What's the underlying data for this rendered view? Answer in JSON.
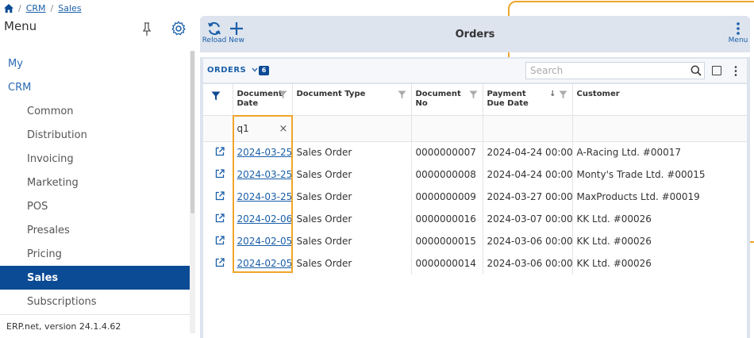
{
  "breadcrumb": {
    "items": [
      "CRM",
      "Sales"
    ]
  },
  "sidebar": {
    "title": "Menu",
    "items": [
      {
        "label": "My",
        "level": 1
      },
      {
        "label": "CRM",
        "level": 1
      },
      {
        "label": "Common",
        "level": 2
      },
      {
        "label": "Distribution",
        "level": 2
      },
      {
        "label": "Invoicing",
        "level": 2
      },
      {
        "label": "Marketing",
        "level": 2
      },
      {
        "label": "POS",
        "level": 2
      },
      {
        "label": "Presales",
        "level": 2
      },
      {
        "label": "Pricing",
        "level": 2
      },
      {
        "label": "Sales",
        "level": 2,
        "active": true
      },
      {
        "label": "Subscriptions",
        "level": 2
      }
    ],
    "version": "ERP.net, version 24.1.4.62"
  },
  "toolbar": {
    "reload_label": "Reload",
    "new_label": "New",
    "title": "Orders",
    "menu_label": "Menu"
  },
  "grid": {
    "orders_label": "ORDERS",
    "count": "6",
    "search_placeholder": "Search",
    "columns": {
      "doc_date": "Document Date",
      "doc_type": "Document Type",
      "doc_no": "Document No",
      "payment_due": "Payment Due Date",
      "customer": "Customer"
    },
    "filter_value": "q1",
    "rows": [
      {
        "date": "2024-03-25",
        "type": "Sales Order",
        "no": "0000000007",
        "due": "2024-04-24 00:00",
        "customer": "A-Racing Ltd. #00017"
      },
      {
        "date": "2024-03-25",
        "type": "Sales Order",
        "no": "0000000008",
        "due": "2024-04-24 00:00",
        "customer": "Monty's Trade Ltd. #00015"
      },
      {
        "date": "2024-03-25",
        "type": "Sales Order",
        "no": "0000000009",
        "due": "2024-03-27 00:00",
        "customer": "MaxProducts Ltd. #00019"
      },
      {
        "date": "2024-02-06",
        "type": "Sales Order",
        "no": "0000000016",
        "due": "2024-03-07 00:00",
        "customer": "KK Ltd. #00026"
      },
      {
        "date": "2024-02-05",
        "type": "Sales Order",
        "no": "0000000015",
        "due": "2024-03-06 00:00",
        "customer": "KK Ltd. #00026"
      },
      {
        "date": "2024-02-05",
        "type": "Sales Order",
        "no": "0000000014",
        "due": "2024-03-06 00:00",
        "customer": "KK Ltd. #00026"
      }
    ]
  },
  "colors": {
    "accent": "#0b4a94",
    "link": "#1a5fa8",
    "highlight": "#f0a52a",
    "toolbar_bg": "#dde4ee"
  }
}
